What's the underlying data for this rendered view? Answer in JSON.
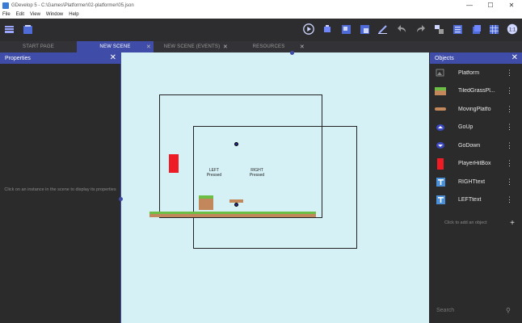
{
  "window": {
    "title": "GDevelop 5 - C:\\Games\\Platformer\\02-platformer\\05.json",
    "minimize": "—",
    "maximize": "☐",
    "close": "✕"
  },
  "menu": [
    "File",
    "Edit",
    "View",
    "Window",
    "Help"
  ],
  "tabs": [
    {
      "label": "START PAGE",
      "active": false
    },
    {
      "label": "NEW SCENE",
      "active": true
    },
    {
      "label": "NEW SCENE (EVENTS)",
      "active": false
    },
    {
      "label": "RESOURCES",
      "active": false
    }
  ],
  "properties": {
    "header": "Properties",
    "hint": "Click on an instance in the scene to display its properties"
  },
  "scene": {
    "left_text": "LEFT\nPressed",
    "right_text": "RIGHT\nPressed"
  },
  "objects": {
    "header": "Objects",
    "items": [
      {
        "label": "Platform",
        "icon": "image-placeholder-icon"
      },
      {
        "label": "TiledGrassPl...",
        "icon": "grass-tile-icon"
      },
      {
        "label": "MovingPlatfo",
        "icon": "moving-platform-icon"
      },
      {
        "label": "GoUp",
        "icon": "arrow-up-sprite-icon"
      },
      {
        "label": "GoDown",
        "icon": "arrow-down-sprite-icon"
      },
      {
        "label": "PlayerHitBox",
        "icon": "red-box-icon"
      },
      {
        "label": "RIGHTtext",
        "icon": "text-object-icon"
      },
      {
        "label": "LEFTtext",
        "icon": "text-object-icon"
      }
    ],
    "add_label": "Click to add an object",
    "search_placeholder": "Search"
  },
  "colors": {
    "accent": "#3f4da8",
    "canvas_bg": "#d6f1f6",
    "panel_bg": "#2b2b2b",
    "grass": "#6cbe45",
    "dirt": "#c2875a",
    "hitbox": "#ee1c24"
  }
}
